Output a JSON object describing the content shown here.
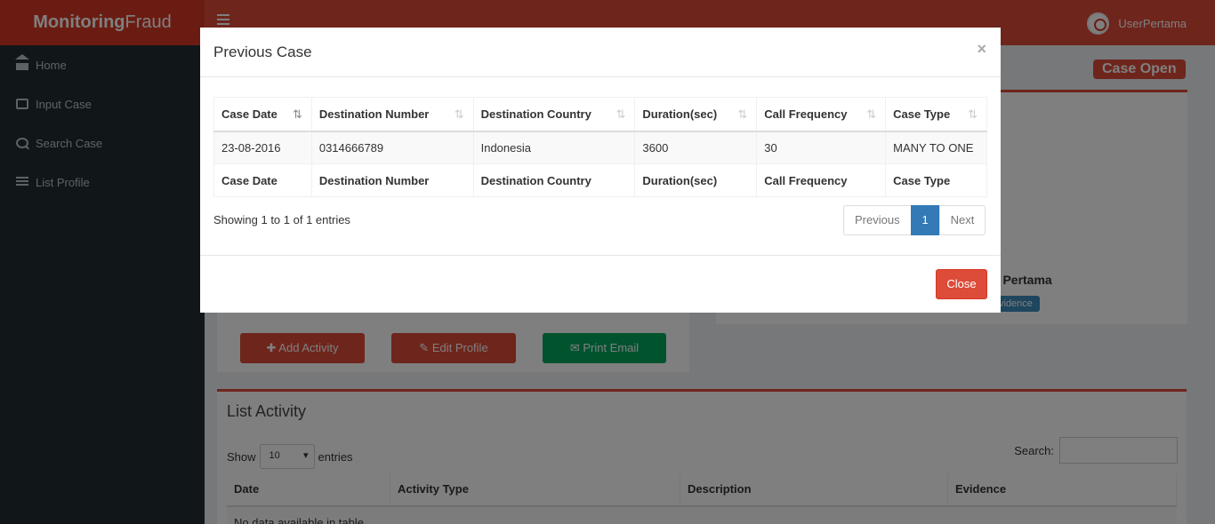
{
  "app": {
    "logo_bold": "Monitoring",
    "logo_light": "Fraud",
    "user_name": "UserPertama",
    "accent": "#dd4b39"
  },
  "sidebar": {
    "items": [
      {
        "label": "Home",
        "icon": "home-icon"
      },
      {
        "label": "Input Case",
        "icon": "edit-icon"
      },
      {
        "label": "Search Case",
        "icon": "search-icon"
      },
      {
        "label": "List Profile",
        "icon": "list-icon"
      }
    ]
  },
  "background": {
    "case_status": "Case Open",
    "profile_name_partial": "g Pertama",
    "evidence_partial": "vidence",
    "buttons": {
      "add_activity": "Add Activity",
      "edit_profile": "Edit Profile",
      "print_email": "Print Email"
    },
    "activity": {
      "title": "List Activity",
      "show_label": "Show",
      "entries_label": "entries",
      "page_size": "10",
      "search_label": "Search:",
      "columns": [
        "Date",
        "Activity Type",
        "Description",
        "Evidence"
      ],
      "empty_text": "No data available in table"
    }
  },
  "modal": {
    "title": "Previous Case",
    "close_x": "×",
    "columns": [
      "Case Date",
      "Destination Number",
      "Destination Country",
      "Duration(sec)",
      "Call Frequency",
      "Case Type"
    ],
    "rows": [
      [
        "23-08-2016",
        "0314666789",
        "Indonesia",
        "3600",
        "30",
        "MANY TO ONE"
      ]
    ],
    "info": "Showing 1 to 1 of 1 entries",
    "pagination": {
      "prev": "Previous",
      "current": "1",
      "next": "Next"
    },
    "close_label": "Close"
  }
}
